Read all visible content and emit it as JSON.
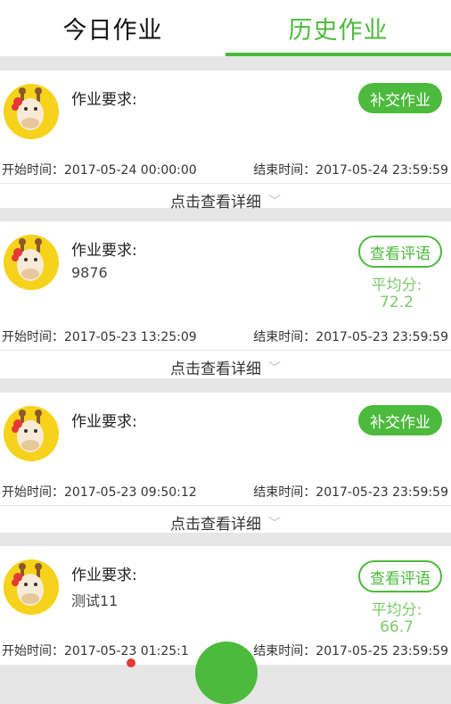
{
  "tabs": [
    {
      "label": "今日作业",
      "active": false
    },
    {
      "label": "历史作业",
      "active": true
    }
  ],
  "accent_color": "#4cba3c",
  "cards": [
    {
      "requirement_label": "作业要求:",
      "requirement_content": "",
      "action": "补交作业",
      "action_style": "filled",
      "start": "开始时间：2017-05-24 00:00:00",
      "end": "结束时间：2017-05-24 23:59:59",
      "detail": "点击查看详细"
    },
    {
      "requirement_label": "作业要求:",
      "requirement_content": "9876",
      "action": "查看评语",
      "action_style": "outline",
      "avg_label": "平均分:",
      "avg_value": "72.2",
      "start": "开始时间：2017-05-23 13:25:09",
      "end": "结束时间：2017-05-23 23:59:59",
      "detail": "点击查看详细"
    },
    {
      "requirement_label": "作业要求:",
      "requirement_content": "",
      "action": "补交作业",
      "action_style": "filled",
      "start": "开始时间：2017-05-23 09:50:12",
      "end": "结束时间：2017-05-23 23:59:59",
      "detail": "点击查看详细"
    },
    {
      "requirement_label": "作业要求:",
      "requirement_content": "测试11",
      "action": "查看评语",
      "action_style": "outline",
      "avg_label": "平均分:",
      "avg_value": "66.7",
      "start": "开始时间：2017-05-23 01:25:1",
      "end": "结束时间：2017-05-25 23:59:59",
      "detail": ""
    }
  ]
}
